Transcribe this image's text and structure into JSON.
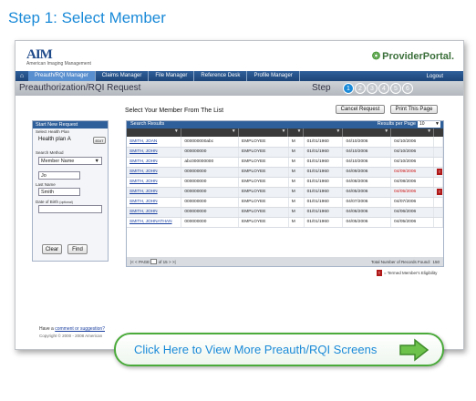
{
  "step_title": "Step 1: Select Member",
  "app": {
    "logo": "AIM",
    "logo_sub": "American Imaging Management",
    "brand": "ProviderPortal."
  },
  "nav": {
    "items": [
      "Preauth/RQI Manager",
      "Claims Manager",
      "File Manager",
      "Reference Desk",
      "Profile Manager"
    ],
    "logout": "Logout"
  },
  "page": {
    "title": "Preauthorization/RQI Request",
    "step_label": "Step",
    "steps": [
      "1",
      "2",
      "3",
      "4",
      "5",
      "6"
    ],
    "active_step": "1"
  },
  "select_title": "Select Your Member From The List",
  "buttons": {
    "cancel": "Cancel Request",
    "print": "Print This Page"
  },
  "left_panel": {
    "head": "Start New Request",
    "health_plan_label": "Select Health Plan",
    "health_plan_value": "Health plan A",
    "edit": "EDIT",
    "search_method_label": "Search Method",
    "search_method_value": "Member Name",
    "first_value": "Jo",
    "last_name_label": "Last Name",
    "last_value": "Smith",
    "dob_label": "Date of Birth",
    "dob_optional": "(optional)",
    "clear": "Clear",
    "find": "Find"
  },
  "results": {
    "title": "Search Results",
    "rpp_label": "Results per Page",
    "rpp_value": "10",
    "rows": [
      [
        "SMITH, JOAN",
        "000000000abc",
        "EMPLOYEE",
        "M",
        "01/01/1960",
        "04/10/2006",
        "04/10/2006",
        ""
      ],
      [
        "SMITH, JOHN",
        "000000000",
        "EMPLOYEE",
        "M",
        "01/01/1960",
        "04/10/2006",
        "04/10/2006",
        ""
      ],
      [
        "SMITH, JOHN",
        "abc000000000",
        "EMPLOYEE",
        "M",
        "01/01/1960",
        "04/10/2006",
        "04/10/2006",
        ""
      ],
      [
        "SMITH, JOHN",
        "000000000",
        "EMPLOYEE",
        "M",
        "01/01/1960",
        "04/09/2006",
        "04/09/2006",
        "T"
      ],
      [
        "SMITH, JOHN",
        "000000000",
        "EMPLOYEE",
        "M",
        "01/01/1960",
        "04/08/2006",
        "04/08/2006",
        ""
      ],
      [
        "SMITH, JOHN",
        "000000000",
        "EMPLOYEE",
        "M",
        "01/01/1960",
        "04/05/2006",
        "04/05/2006",
        "T"
      ],
      [
        "SMITH, JOHN",
        "000000000",
        "EMPLOYEE",
        "M",
        "01/01/1960",
        "04/07/2006",
        "04/07/2006",
        ""
      ],
      [
        "SMITH, JOHN",
        "000000000",
        "EMPLOYEE",
        "M",
        "01/01/1960",
        "04/06/2006",
        "04/06/2006",
        ""
      ],
      [
        "SMITH, JOHNATHAN",
        "000000000",
        "EMPLOYEE",
        "M",
        "01/01/1960",
        "04/05/2006",
        "04/05/2006",
        ""
      ]
    ],
    "red_rows": [
      3,
      5
    ],
    "pager_page": "PAGE",
    "pager_of": "of 15",
    "pager_total_label": "Total Number of Records Found:",
    "pager_total": "150"
  },
  "legend": "= Termed Member's Eligibility",
  "footer": {
    "have": "Have a",
    "link": "comment or suggestion?",
    "copyright": "Copyright © 2000 - 2008 American"
  },
  "cta": "Click Here to View More Preauth/RQI Screens",
  "colors": {
    "accent": "#1a8ad8",
    "nav": "#2f5f9a",
    "cta_border": "#4aaa3a",
    "termed": "#cc1111"
  }
}
